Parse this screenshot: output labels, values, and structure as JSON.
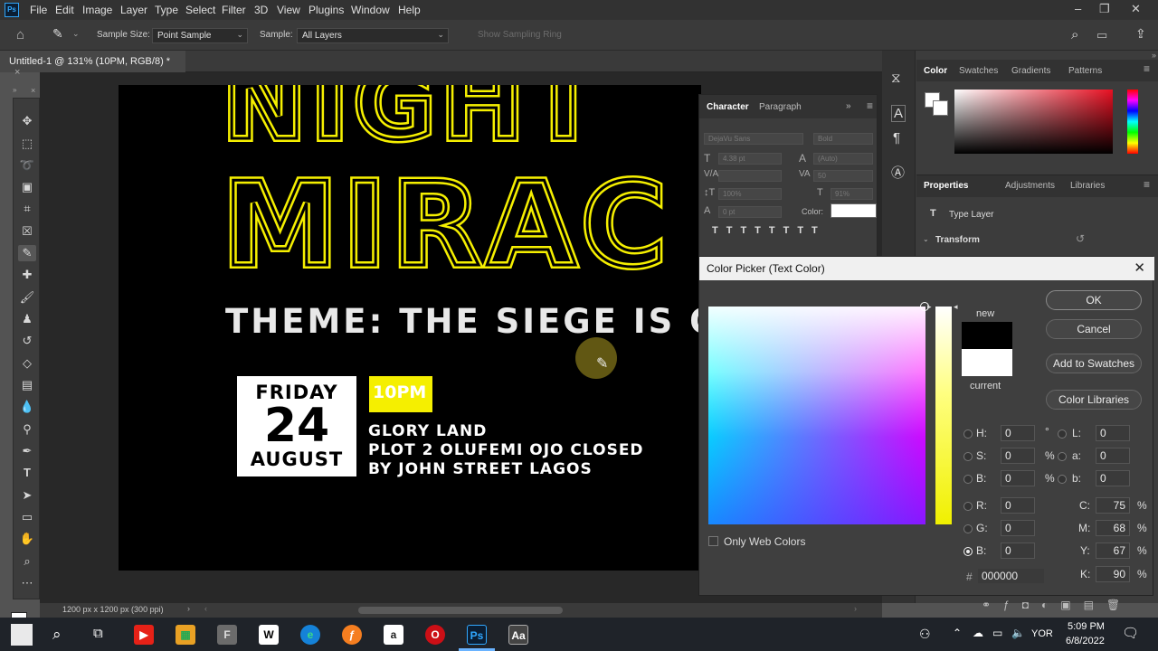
{
  "menubar": {
    "logo": "Ps",
    "items": [
      "File",
      "Edit",
      "Image",
      "Layer",
      "Type",
      "Select",
      "Filter",
      "3D",
      "View",
      "Plugins",
      "Window",
      "Help"
    ]
  },
  "options": {
    "sample_size_label": "Sample Size:",
    "sample_size_value": "Point Sample",
    "sample_label": "Sample:",
    "sample_value": "All Layers",
    "sampling_ring": "Show Sampling Ring"
  },
  "document": {
    "tab_title": "Untitled-1 @ 131% (10PM, RGB/8) *",
    "status": "1200 px x 1200 px (300 ppi)"
  },
  "artwork": {
    "line1": "NIGHT",
    "line2": "MIRAC",
    "theme": "THEME: THE SIEGE IS O",
    "day": "FRIDAY",
    "date": "24",
    "month": "AUGUST",
    "time": "10PM",
    "venue1": "GLORY LAND",
    "venue2": "PLOT 2 OLUFEMI OJO CLOSED",
    "venue3": "BY JOHN STREET LAGOS"
  },
  "character_panel": {
    "tab_character": "Character",
    "tab_paragraph": "Paragraph",
    "font": "DejaVu Sans",
    "style": "Bold",
    "size": "4.38 pt",
    "leading": "(Auto)",
    "tracking": "50",
    "vscale": "100%",
    "hscale": "91%",
    "baseline": "0 pt",
    "color_label": "Color:"
  },
  "color_panel": {
    "tabs": [
      "Color",
      "Swatches",
      "Gradients",
      "Patterns"
    ]
  },
  "properties_panel": {
    "tabs": [
      "Properties",
      "Adjustments",
      "Libraries"
    ],
    "layer_type": "Type Layer",
    "section": "Transform"
  },
  "color_picker": {
    "title": "Color Picker (Text Color)",
    "new_label": "new",
    "current_label": "current",
    "ok": "OK",
    "cancel": "Cancel",
    "add_swatches": "Add to Swatches",
    "libraries": "Color Libraries",
    "only_web": "Only Web Colors",
    "H": "0",
    "S": "0",
    "Bv": "0",
    "R": "0",
    "G": "0",
    "B": "0",
    "L": "0",
    "a": "0",
    "b": "0",
    "C": "75",
    "M": "68",
    "Y": "67",
    "K": "90",
    "hex": "000000",
    "deg": "°",
    "pct": "%",
    "hash": "#",
    "new_color": "#000000",
    "current_color": "#ffffff"
  },
  "taskbar": {
    "lang": "YOR",
    "time": "5:09 PM",
    "date": "6/8/2022"
  },
  "colors": {
    "accent_yellow": "#f5ef00",
    "ps_blue": "#31a8ff"
  }
}
